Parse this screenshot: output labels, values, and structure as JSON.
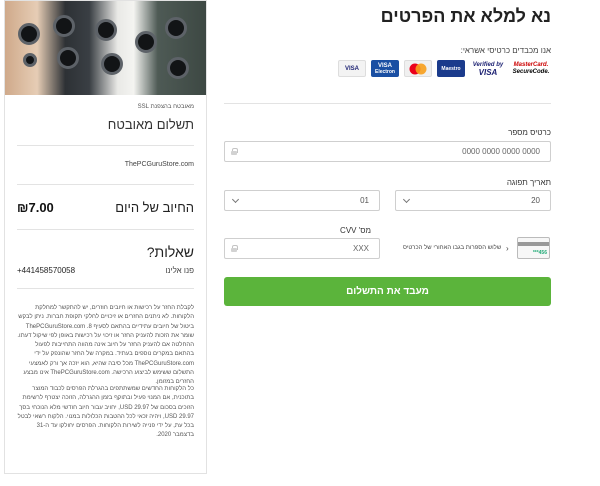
{
  "summary": {
    "ssl_note": "מאובטח בהצפנת SSL",
    "title": "תשלום מאובטח",
    "store": "ThePCGuruStore.com",
    "today_label": "החיוב של היום",
    "today_amount": "₪7.00",
    "questions_title": "שאלות?",
    "contact_label": "פנו אלינו",
    "contact_phone": "+441458570058",
    "fine_print_1": "לקבלת החזר על רכישות או חיובים חוזרים, יש להתקשר למחלקת הלקוחות. לא ניתנים החזרים או זיכויים לחלקי תקופת חברות. ניתן לבקש ביטול של חיובים עתידיים בהתאם לסעיף 8. ThePCGuruStore.com שומר את הזכות להעניק החזר או זיכוי על רכישות באופן לפי שיקול דעתו. ההחלטה אם להעניק החזר על חיוב אינה מהווה התחייבות לפעול בהתאם במקרים נוספים בעתיד. במקרה של החזר שהונפק על ידי ThePCGuruStore.com מכל סיבה שהיא, הוא יזכה אך ורק לאמצעי התשלום ששימש לביצוע הרכישה. ThePCGuruStore.com אינו מבצע החזרים במזומן.",
    "fine_print_2": "כל הלקוחות החדשים שמשתתפים בהגרלת הפרסים לכבוד המוצר בתוכנית, אם המנוי פעיל ובתוקף בזמן ההגרלה, הזוכה יצטרף לרשימת הזוכים בסכום של 29.97 USD, יחויב עבור חיוב חודשי מלא הנוכחי בסך 29.97 USD, ויהיה זכאי לכל ההטבות הכלולות במנוי. הלקוח רשאי לבטל בכל עת, על ידי פנייה לשירות הלקוחות. הפרסים יחולקו עד ה-31 בדצמבר 2020."
  },
  "form": {
    "title": "נא למלא את הפרטים",
    "accept_text": "אנו מכבדים כרטיסי אשראי:",
    "logos": [
      {
        "name": "mastercard-securecode-logo",
        "line1": "MasterCard.",
        "line2": "SecureCode."
      },
      {
        "name": "verified-by-visa-logo",
        "line1": "Verified by",
        "line2": "VISA"
      },
      {
        "name": "maestro-logo",
        "line1": "Maestro",
        "line2": ""
      },
      {
        "name": "mastercard-logo",
        "line1": "",
        "line2": ""
      },
      {
        "name": "visa-electron-logo",
        "line1": "VISA",
        "line2": "Electron"
      },
      {
        "name": "visa-logo",
        "line1": "VISA",
        "line2": ""
      }
    ],
    "card_number_label": "כרטיס מספר",
    "card_number_placeholder": "0000 0000 0000 0000",
    "expiry_label": "תאריך תפוגה",
    "expiry_year": "20",
    "expiry_month": "01",
    "cvv_label": "מס' CVV",
    "cvv_placeholder": "XXX",
    "cvv_hint": "שלוש הספרות בגבו האחורי של הכרטיס",
    "card_thumb_digits": "***456",
    "pay_button": "מעבד את התשלום"
  },
  "colors": {
    "pay_button": "#5bb43b",
    "border": "#cfcfcf"
  }
}
